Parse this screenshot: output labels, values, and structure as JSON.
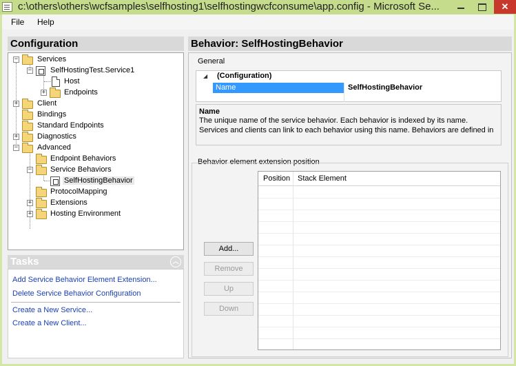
{
  "window": {
    "title": "c:\\others\\others\\wcfsamples\\selfhosting1\\selfhostingwcfconsume\\app.config - Microsoft Se..."
  },
  "menu": {
    "file": "File",
    "help": "Help"
  },
  "config_panel": {
    "title": "Configuration",
    "tree": [
      {
        "label": "Services"
      },
      {
        "label": "SelfHostingTest.Service1"
      },
      {
        "label": "Host"
      },
      {
        "label": "Endpoints"
      },
      {
        "label": "Client"
      },
      {
        "label": "Bindings"
      },
      {
        "label": "Standard Endpoints"
      },
      {
        "label": "Diagnostics"
      },
      {
        "label": "Advanced"
      },
      {
        "label": "Endpoint Behaviors"
      },
      {
        "label": "Service Behaviors"
      },
      {
        "label": "SelfHostingBehavior"
      },
      {
        "label": "ProtocolMapping"
      },
      {
        "label": "Extensions"
      },
      {
        "label": "Hosting Environment"
      }
    ]
  },
  "tasks": {
    "title": "Tasks",
    "links": [
      "Add Service Behavior Element Extension...",
      "Delete Service Behavior Configuration",
      "Create a New Service...",
      "Create a New Client..."
    ]
  },
  "behavior": {
    "title": "Behavior: SelfHostingBehavior",
    "general_label": "General",
    "category": "(Configuration)",
    "prop_name": "Name",
    "prop_value": "SelfHostingBehavior",
    "desc_title": "Name",
    "desc_text": "The unique name of the service behavior. Each behavior is indexed by its name. Services and clients can link to each behavior using this name. Behaviors are defined in the <servi...",
    "ext_label": "Behavior element extension position",
    "buttons": {
      "add": "Add...",
      "remove": "Remove",
      "up": "Up",
      "down": "Down"
    },
    "columns": [
      "Position",
      "Stack Element"
    ]
  }
}
